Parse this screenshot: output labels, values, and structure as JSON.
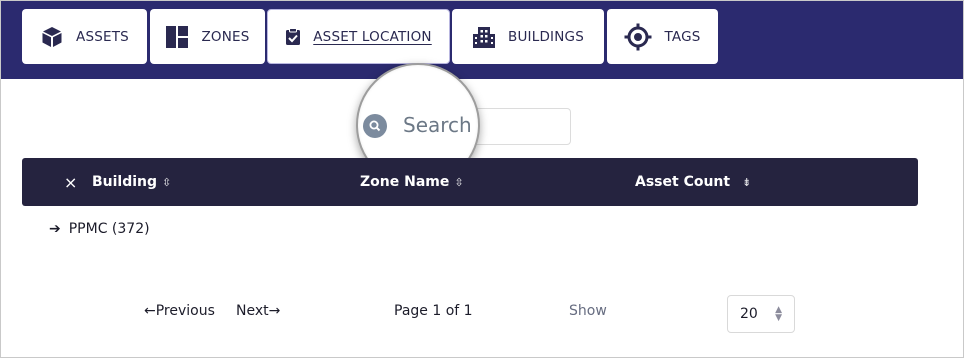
{
  "nav": {
    "tabs": [
      {
        "label": "ASSETS",
        "icon": "cube-icon"
      },
      {
        "label": "ZONES",
        "icon": "zones-grid-icon"
      },
      {
        "label": "ASSET LOCATION",
        "icon": "clipboard-check-icon",
        "active": true
      },
      {
        "label": "BUILDINGS",
        "icon": "building-icon"
      },
      {
        "label": "TAGS",
        "icon": "target-icon"
      }
    ]
  },
  "search": {
    "placeholder": "Search"
  },
  "table": {
    "clear_icon": "×",
    "columns": [
      {
        "label": "Building",
        "sort_icon": "⇳"
      },
      {
        "label": "Zone Name",
        "sort_icon": "⇳"
      },
      {
        "label": "Asset Count",
        "sort_icon": "⇟"
      }
    ],
    "rows": [
      {
        "arrow": "➔",
        "label": "PPMC (372)"
      }
    ]
  },
  "pagination": {
    "previous": "←Previous",
    "next": "Next→",
    "page_info": "Page 1 of 1",
    "show_label": "Show",
    "page_size": "20"
  },
  "colors": {
    "nav_bg": "#2b2a6f",
    "table_header_bg": "#25233f",
    "icon_color": "#2a2950"
  }
}
